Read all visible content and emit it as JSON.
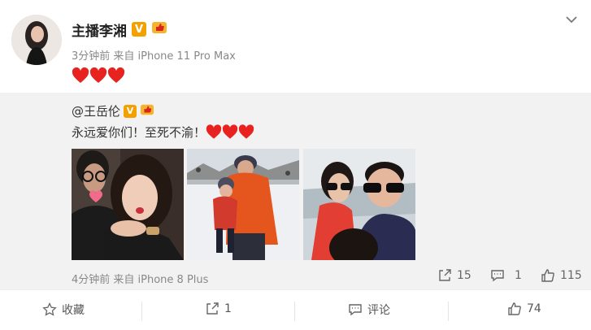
{
  "post": {
    "author": "主播李湘",
    "meta": "3分钟前 来自 iPhone 11 Pro Max",
    "vip_badge": "V",
    "heart_color": "#e8231f"
  },
  "repost": {
    "mention": "@王岳伦",
    "vip_badge": "V",
    "text": "永远爱你们！至死不渝！",
    "meta": "4分钟前 来自 iPhone 8 Plus",
    "shares": "15",
    "comments": "1",
    "likes": "115"
  },
  "actions": {
    "favorite": "收藏",
    "share": "1",
    "comment": "评论",
    "like": "74"
  },
  "colors": {
    "badge": "#f2a100",
    "meta_text": "#888888",
    "repost_bg": "#f2f2f2"
  }
}
